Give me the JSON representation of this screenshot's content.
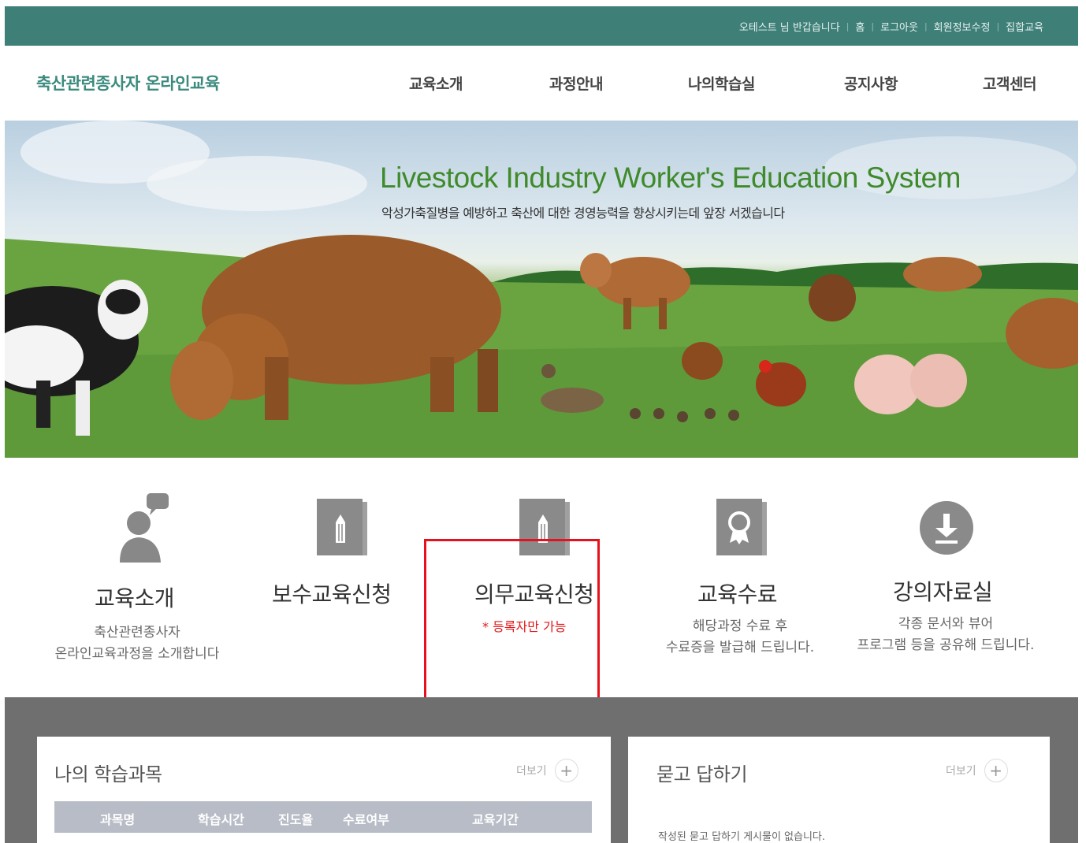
{
  "topbar": {
    "links": [
      "오테스트 님 반갑습니다",
      "홈",
      "로그아웃",
      "회원정보수정",
      "집합교육"
    ]
  },
  "header": {
    "logo": "축산관련종사자 온라인교육",
    "nav": [
      "교육소개",
      "과정안내",
      "나의학습실",
      "공지사항",
      "고객센터"
    ]
  },
  "hero": {
    "title": "Livestock Industry Worker's Education System",
    "subtitle": "악성가축질병을 예방하고 축산에 대한 경영능력을 향상시키는데 앞장 서겠습니다"
  },
  "quick_menu": [
    {
      "title": "교육소개",
      "desc": [
        "축산관련종사자",
        "온라인교육과정을 소개합니다"
      ],
      "icon": "person-speech-icon"
    },
    {
      "title": "보수교육신청",
      "desc": [],
      "icon": "pencil-document-icon"
    },
    {
      "title": "의무교육신청",
      "note": "* 등록자만 가능",
      "desc": [],
      "icon": "pencil-document-icon"
    },
    {
      "title": "교육수료",
      "desc": [
        "해당과정 수료 후",
        "수료증을 발급해 드립니다."
      ],
      "icon": "certificate-icon"
    },
    {
      "title": "강의자료실",
      "desc": [
        "각종 문서와 뷰어",
        "프로그램 등을 공유해 드립니다."
      ],
      "icon": "download-icon"
    }
  ],
  "my_courses": {
    "title": "나의 학습과목",
    "more": "더보기",
    "columns": [
      "과목명",
      "학습시간",
      "진도율",
      "수료여부",
      "교육기간"
    ]
  },
  "qna": {
    "title": "묻고 답하기",
    "more": "더보기",
    "empty": "작성된 묻고 답하기 게시물이 없습니다."
  },
  "colors": {
    "topbar": "#3e7f78",
    "logo": "#3b8a7e",
    "hero_title": "#3f8a2a",
    "note_red": "#e0191b",
    "highlight": "#e8101a",
    "band": "#6f6f6f"
  }
}
